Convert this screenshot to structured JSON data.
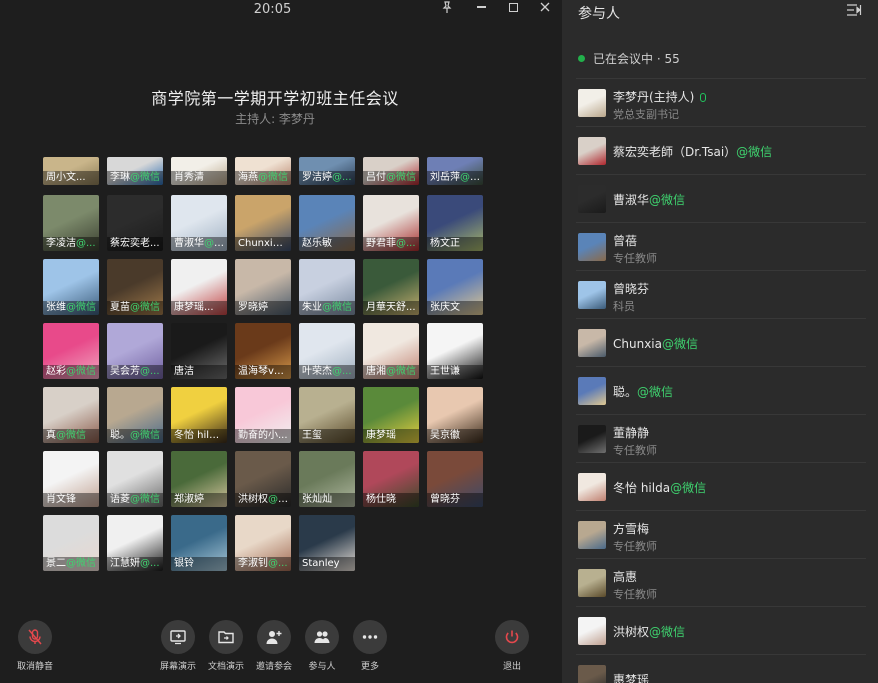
{
  "window": {
    "time": "20:05"
  },
  "meeting": {
    "title": "商学院第一学期开学初班主任会议",
    "host_line": "主持人: 李梦丹"
  },
  "colors": {
    "accent_green": "#3fd36f",
    "online_dot": "#22b04b",
    "exit_red": "#e5484d"
  },
  "tiles_top": [
    {
      "name": "周小文...",
      "wx": ""
    },
    {
      "name": "李琳",
      "wx": "@微信"
    },
    {
      "name": "肖秀清",
      "wx": ""
    },
    {
      "name": "海燕",
      "wx": "@微信"
    },
    {
      "name": "罗洁婷",
      "wx": "@..."
    },
    {
      "name": "吕付",
      "wx": "@微信"
    },
    {
      "name": "刘岳萍",
      "wx": "@微信"
    }
  ],
  "tiles": [
    {
      "name": "李凌洁",
      "wx": "@..."
    },
    {
      "name": "蔡宏奕老...",
      "wx": ""
    },
    {
      "name": "曹淑华",
      "wx": "@微信"
    },
    {
      "name": "Chunxia...",
      "wx": ""
    },
    {
      "name": "赵乐敏",
      "wx": ""
    },
    {
      "name": "野君菲",
      "wx": "@..."
    },
    {
      "name": "杨文正",
      "wx": ""
    },
    {
      "name": "张维",
      "wx": "@微信"
    },
    {
      "name": "夏苗",
      "wx": "@微信"
    },
    {
      "name": "康梦瑶...",
      "wx": ""
    },
    {
      "name": "罗晓婷",
      "wx": ""
    },
    {
      "name": "朱业",
      "wx": "@微信"
    },
    {
      "name": "月華天舒...",
      "wx": ""
    },
    {
      "name": "张庆文",
      "wx": ""
    },
    {
      "name": "赵彩",
      "wx": "@微信"
    },
    {
      "name": "吴会芳",
      "wx": "@..."
    },
    {
      "name": "唐洁",
      "wx": ""
    },
    {
      "name": "温海琴ve...",
      "wx": ""
    },
    {
      "name": "叶荣杰",
      "wx": "@..."
    },
    {
      "name": "唐湘",
      "wx": "@微信"
    },
    {
      "name": "王世谦",
      "wx": ""
    },
    {
      "name": "真",
      "wx": "@微信"
    },
    {
      "name": "聪。",
      "wx": "@微信"
    },
    {
      "name": "冬怡 hild...",
      "wx": ""
    },
    {
      "name": "勤奋的小...",
      "wx": ""
    },
    {
      "name": "王玺",
      "wx": ""
    },
    {
      "name": "康梦瑶",
      "wx": ""
    },
    {
      "name": "吴京徽",
      "wx": ""
    },
    {
      "name": "肖文锋",
      "wx": ""
    },
    {
      "name": "语菱",
      "wx": "@微信"
    },
    {
      "name": "郑淑婷",
      "wx": ""
    },
    {
      "name": "洪树权",
      "wx": "@微信"
    },
    {
      "name": "张灿灿",
      "wx": ""
    },
    {
      "name": "杨仕晓",
      "wx": ""
    },
    {
      "name": "曾晓芬",
      "wx": ""
    },
    {
      "name": "景二",
      "wx": "@微信"
    },
    {
      "name": "江慧妍",
      "wx": "@..."
    },
    {
      "name": "银铃",
      "wx": ""
    },
    {
      "name": "李淑钊",
      "wx": "@..."
    },
    {
      "name": "Stanley",
      "wx": ""
    }
  ],
  "controls": {
    "unmute": "取消静音",
    "screen_share": "屏幕演示",
    "doc_share": "文档演示",
    "invite": "邀请参会",
    "participants": "参与人",
    "more": "更多",
    "exit": "退出"
  },
  "panel": {
    "title": "参与人",
    "in_meeting": "已在会议中 · 55",
    "participants": [
      {
        "name": "李梦丹(主持人)",
        "wx": "",
        "role": "党总支副书记",
        "mic": "mic-icon"
      },
      {
        "name": "蔡宏奕老師（Dr.Tsai）",
        "wx": "@微信",
        "role": ""
      },
      {
        "name": "曹淑华",
        "wx": "@微信",
        "role": ""
      },
      {
        "name": "曾蓓",
        "wx": "",
        "role": "专任教师"
      },
      {
        "name": "曾晓芬",
        "wx": "",
        "role": "科员"
      },
      {
        "name": "Chunxia",
        "wx": "@微信",
        "role": ""
      },
      {
        "name": "聪。",
        "wx": "@微信",
        "role": ""
      },
      {
        "name": "董静静",
        "wx": "",
        "role": "专任教师"
      },
      {
        "name": "冬怡 hilda",
        "wx": "@微信",
        "role": ""
      },
      {
        "name": "方雪梅",
        "wx": "",
        "role": "专任教师"
      },
      {
        "name": "高惠",
        "wx": "",
        "role": "专任教师"
      },
      {
        "name": "洪树权",
        "wx": "@微信",
        "role": ""
      },
      {
        "name": "惠梦瑶",
        "wx": "",
        "role": ""
      }
    ]
  }
}
